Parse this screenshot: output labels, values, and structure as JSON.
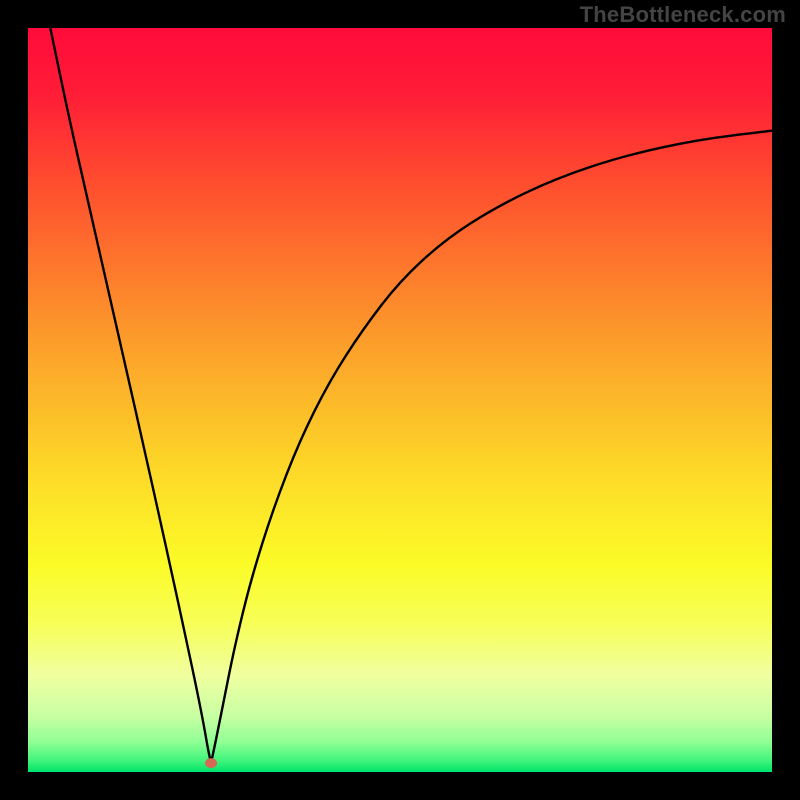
{
  "watermark": "TheBottleneck.com",
  "chart_data": {
    "type": "line",
    "title": "",
    "xlabel": "",
    "ylabel": "",
    "xlim": [
      0,
      100
    ],
    "ylim": [
      0,
      100
    ],
    "grid": false,
    "legend": false,
    "background_gradient_stops": [
      {
        "pct": 0.0,
        "color": "#ff0b3a"
      },
      {
        "pct": 9.0,
        "color": "#ff1d37"
      },
      {
        "pct": 20.0,
        "color": "#ff4a2f"
      },
      {
        "pct": 33.0,
        "color": "#fd7b2c"
      },
      {
        "pct": 46.0,
        "color": "#fcab2a"
      },
      {
        "pct": 60.0,
        "color": "#fdda28"
      },
      {
        "pct": 72.0,
        "color": "#fbfb27"
      },
      {
        "pct": 80.0,
        "color": "#f7ff57"
      },
      {
        "pct": 87.0,
        "color": "#f0ffa0"
      },
      {
        "pct": 92.5,
        "color": "#c8ffa3"
      },
      {
        "pct": 96.0,
        "color": "#8fff94"
      },
      {
        "pct": 98.5,
        "color": "#40f47c"
      },
      {
        "pct": 100.0,
        "color": "#00e36a"
      }
    ],
    "marker": {
      "x": 24.6,
      "y": 1.2,
      "color": "#d46a56",
      "rx": 6,
      "ry": 5
    },
    "series": [
      {
        "name": "left-branch",
        "stroke": "#000000",
        "width": 2.4,
        "x": [
          3.0,
          5.5,
          8.0,
          10.5,
          13.0,
          15.5,
          17.5,
          19.5,
          21.0,
          22.5,
          23.6,
          24.2,
          24.6
        ],
        "y": [
          100.0,
          88.0,
          77.0,
          66.0,
          55.0,
          44.0,
          35.0,
          26.0,
          19.0,
          12.0,
          6.5,
          3.0,
          1.2
        ]
      },
      {
        "name": "right-branch",
        "stroke": "#000000",
        "width": 2.4,
        "x": [
          24.6,
          25.2,
          26.2,
          27.8,
          30.0,
          33.0,
          36.5,
          40.5,
          45.0,
          50.0,
          56.0,
          63.0,
          71.0,
          80.0,
          90.0,
          100.0
        ],
        "y": [
          1.2,
          4.0,
          9.0,
          17.0,
          26.0,
          35.5,
          44.5,
          52.5,
          59.5,
          66.0,
          71.5,
          76.0,
          79.8,
          82.8,
          85.0,
          86.2
        ]
      }
    ]
  }
}
